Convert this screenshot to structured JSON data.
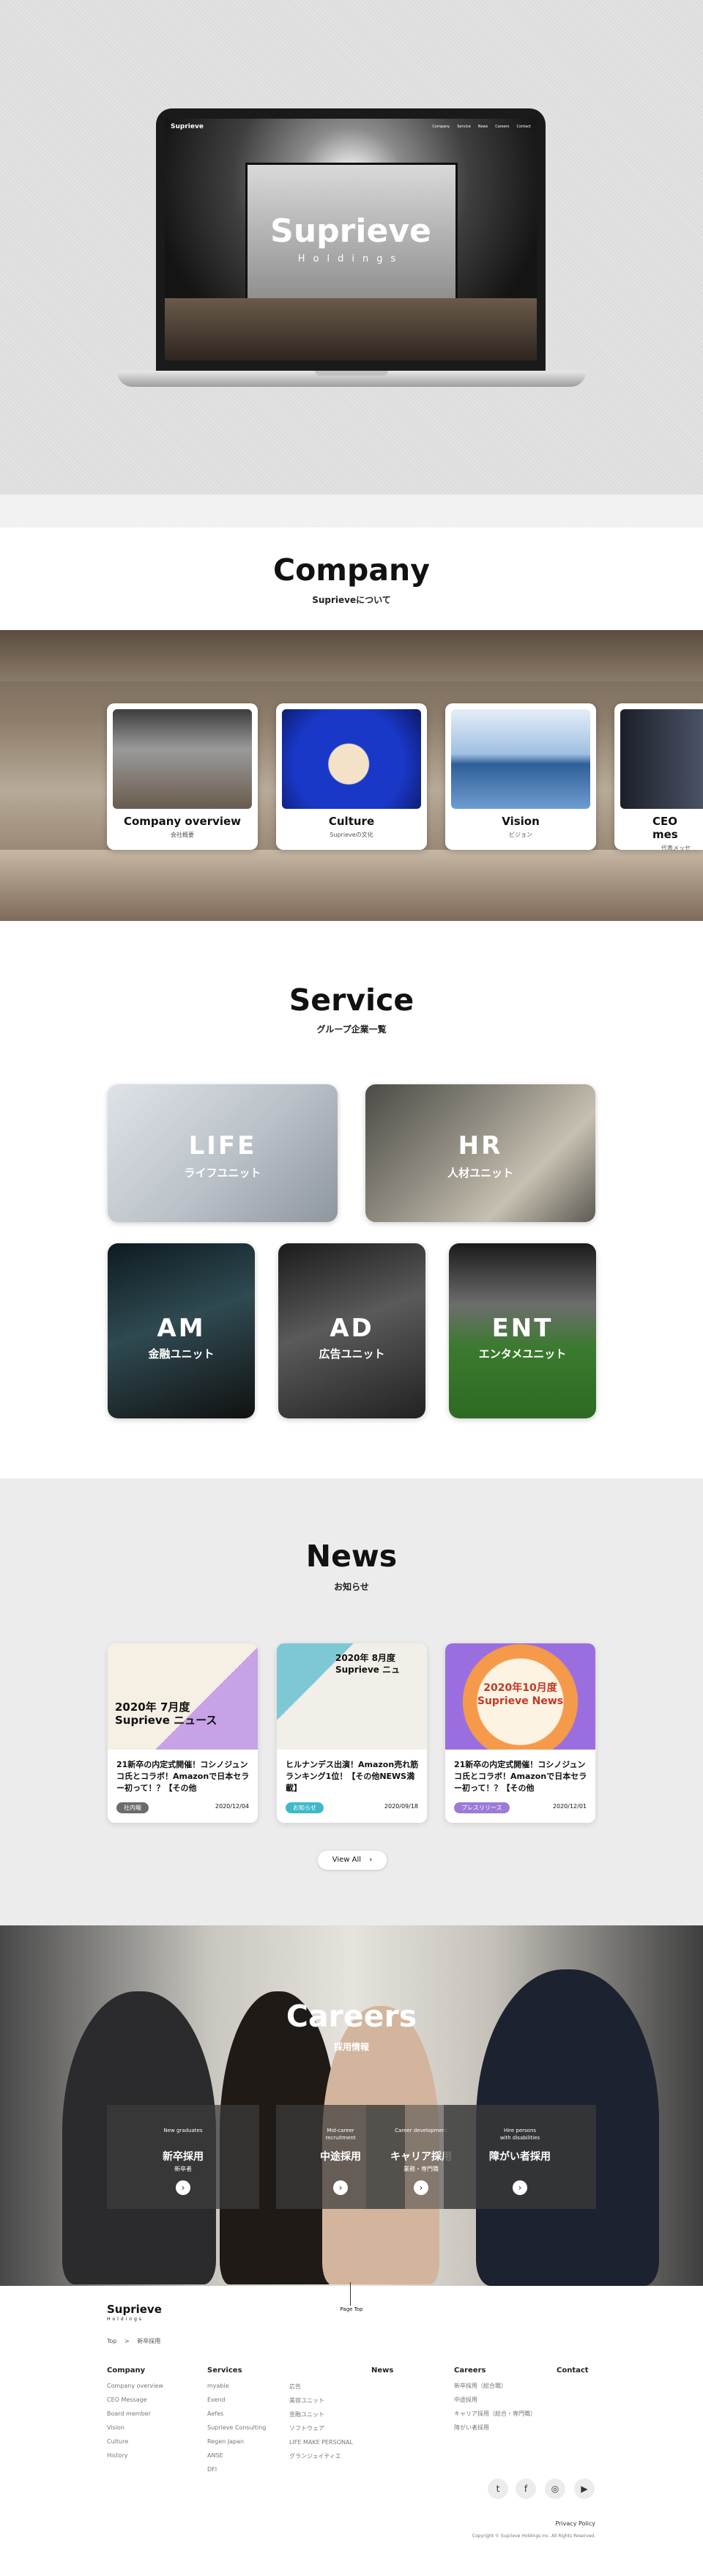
{
  "hero": {
    "logo": "Suprieve",
    "nav": [
      "Company",
      "Service",
      "News",
      "Careers",
      "Contact"
    ],
    "title": "Suprieve",
    "subtitle": "Holdings"
  },
  "company": {
    "title": "Company",
    "subtitle": "Suprieveについて",
    "cards": [
      {
        "label": "Company overview",
        "sub": "会社概要"
      },
      {
        "label": "Culture",
        "sub": "Suprieveの文化"
      },
      {
        "label": "Vision",
        "sub": "ビジョン"
      },
      {
        "label": "CEO mes",
        "sub": "代表メッセ"
      }
    ]
  },
  "service": {
    "title": "Service",
    "subtitle": "グループ企業一覧",
    "units": [
      {
        "abbr": "LIFE",
        "jp": "ライフユニット"
      },
      {
        "abbr": "HR",
        "jp": "人材ユニット"
      },
      {
        "abbr": "AM",
        "jp": "金融ユニット"
      },
      {
        "abbr": "AD",
        "jp": "広告ユニット"
      },
      {
        "abbr": "ENT",
        "jp": "エンタメユニット"
      }
    ]
  },
  "news": {
    "title": "News",
    "subtitle": "お知らせ",
    "items": [
      {
        "img_text": "2020年 7月度\nSuprieve ニュース",
        "title": "21新卒の内定式開催！コシノジュンコ氏とコラボ！Amazonで日本セラー初って！？【その他",
        "tag": "社内報",
        "date": "2020/12/04",
        "tag_color": "#6b6b6b"
      },
      {
        "img_text": "2020年 8月度\nSuprieve ニュ",
        "title": "ヒルナンデス出演！Amazon売れ筋ランキング1位！【その他NEWS満載】",
        "tag": "お知らせ",
        "date": "2020/09/18",
        "tag_color": "#3fb9c9"
      },
      {
        "img_text": "2020年10月度\nSuprieve News",
        "title": "21新卒の内定式開催！コシノジュンコ氏とコラボ！Amazonで日本セラー初って！？【その他",
        "tag": "プレスリリース",
        "date": "2020/12/01",
        "tag_color": "#9b7ad8"
      }
    ],
    "view_all": "View All"
  },
  "careers": {
    "title": "Careers",
    "subtitle": "採用情報",
    "cards": [
      {
        "en": "New graduates",
        "jp": "新卒採用",
        "sub": "新卒者"
      },
      {
        "en": "Mid-career\nrecruitment",
        "jp": "中途採用",
        "sub": ""
      },
      {
        "en": "Career development",
        "jp": "キャリア採用",
        "sub": "業務・専門職"
      },
      {
        "en": "Hire persons\nwith disabilities",
        "jp": "障がい者採用",
        "sub": ""
      }
    ]
  },
  "footer": {
    "logo": "Suprieve",
    "logo_sub": "Holdings",
    "page_top": "Page Top",
    "breadcrumb": [
      "Top",
      "新卒採用"
    ],
    "columns": [
      {
        "head": "Company",
        "links": [
          "Company overview",
          "CEO Message",
          "Board member",
          "Vision",
          "Culture",
          "History"
        ]
      },
      {
        "head": "Services",
        "links": [
          "myable",
          "Exend",
          "Aefes",
          "Suprieve Consulting",
          "Regen Japan",
          "ANSE",
          "DFI"
        ]
      },
      {
        "head": "",
        "links": [
          "広告",
          "美容ユニット",
          "金融ユニット",
          "ソフトウェア",
          "LIFE MAKE PERSONAL",
          "グランジュイティエ"
        ]
      },
      {
        "head": "News",
        "links": []
      },
      {
        "head": "Careers",
        "links": [
          "新卒採用（総合職）",
          "中途採用",
          "キャリア採用（総合・専門職）",
          "障がい者採用"
        ]
      },
      {
        "head": "Contact",
        "links": []
      }
    ],
    "social": [
      "twitter-icon",
      "facebook-icon",
      "instagram-icon",
      "youtube-icon"
    ],
    "privacy": "Privacy Policy",
    "copyright": "Copyright © Suprieve Holdings Inc. All Rights Reserved."
  }
}
